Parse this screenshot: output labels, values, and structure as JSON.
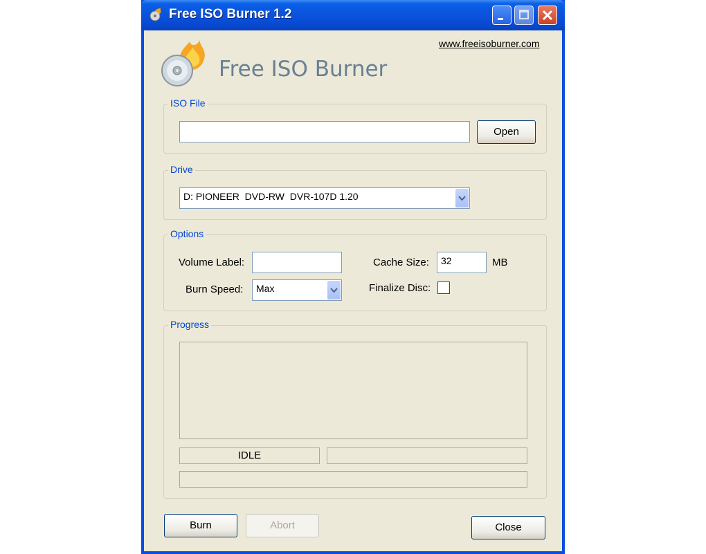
{
  "window": {
    "title": "Free ISO Burner 1.2"
  },
  "header": {
    "website_link": "www.freeisoburner.com",
    "app_name": "Free ISO Burner"
  },
  "iso_file": {
    "group_label": "ISO File",
    "path_value": "",
    "open_button": "Open"
  },
  "drive": {
    "group_label": "Drive",
    "selected": "D: PIONEER  DVD-RW  DVR-107D 1.20"
  },
  "options": {
    "group_label": "Options",
    "volume_label": "Volume Label:",
    "volume_value": "",
    "burn_speed_label": "Burn Speed:",
    "burn_speed_selected": "Max",
    "cache_size_label": "Cache Size:",
    "cache_size_value": "32",
    "cache_unit": "MB",
    "finalize_label": "Finalize Disc:",
    "finalize_checked": false
  },
  "progress": {
    "group_label": "Progress",
    "status_text": "IDLE",
    "status_detail": "",
    "progress_fraction": 0
  },
  "buttons": {
    "burn": "Burn",
    "abort": "Abort",
    "close": "Close"
  },
  "colors": {
    "group_title": "#0046d5",
    "dialog_bg": "#ece9d8",
    "titlebar": "#0b52dc"
  }
}
